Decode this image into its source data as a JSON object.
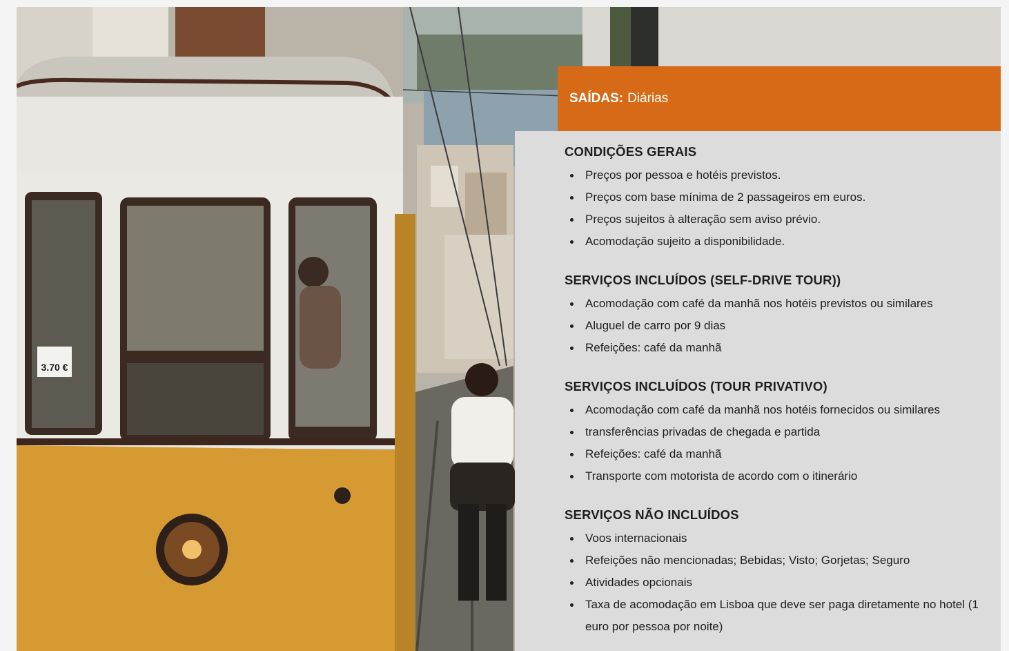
{
  "banner": {
    "label": "SAÍDAS:",
    "value": "Diárias"
  },
  "sections": [
    {
      "title": "CONDIÇÕES GERAIS",
      "items": [
        "Preços por pessoa e hotéis previstos.",
        "Preços com base mínima de 2 passageiros em euros.",
        "Preços sujeitos à alteração sem aviso prévio.",
        "Acomodação sujeito a disponibilidade."
      ]
    },
    {
      "title": "SERVIÇOS INCLUÍDOS (SELF-DRIVE TOUR))",
      "items": [
        "Acomodação com café da manhã nos hotéis previstos ou similares",
        "Aluguel de carro por 9 dias",
        "Refeições: café da manhã"
      ]
    },
    {
      "title": "SERVIÇOS INCLUÍDOS (TOUR PRIVATIVO)",
      "items": [
        "Acomodação com café da manhã nos hotéis fornecidos ou similares",
        "transferências privadas de chegada e partida",
        "Refeições: café da manhã",
        "Transporte com motorista de acordo com o itinerário"
      ]
    },
    {
      "title": "SERVIÇOS NÃO INCLUÍDOS",
      "items": [
        "Voos internacionais",
        "Refeições não mencionadas; Bebidas; Visto; Gorjetas; Seguro",
        "Atividades opcionais",
        "Taxa de acomodação em Lisboa que deve ser paga diretamente no hotel (1 euro por pessoa por noite)"
      ]
    }
  ],
  "photo": {
    "subject": "lisbon-tram-street",
    "fare_sign": "3.70 €"
  },
  "colors": {
    "accent": "#d66a17",
    "panel": "#dcdcdc",
    "tram_yellow": "#d69a33"
  }
}
